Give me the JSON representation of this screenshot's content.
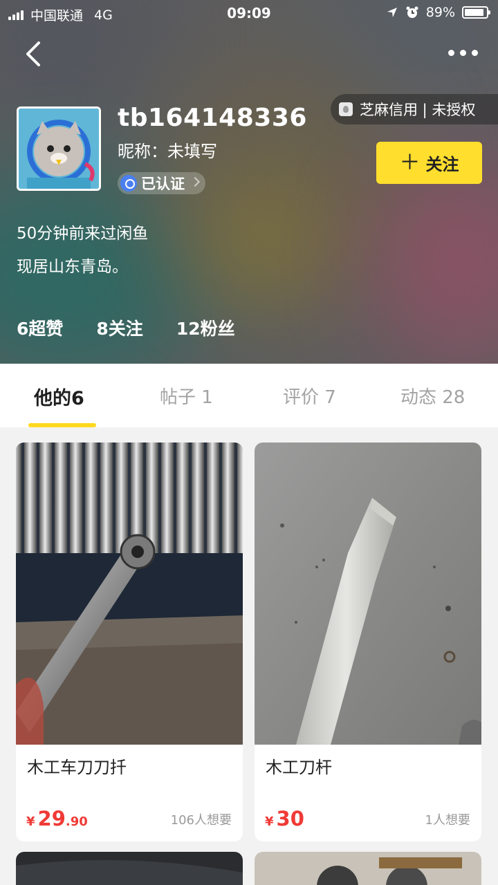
{
  "status_bar": {
    "carrier": "中国联通",
    "network": "4G",
    "time": "09:09",
    "battery": "89%",
    "battery_level": 0.89
  },
  "profile": {
    "username": "tb164148336",
    "nickname": "昵称：未填写",
    "verified_label": "已认证",
    "credit": "芝麻信用 | 未授权",
    "follow_label": "关注",
    "last_seen": "50分钟前来过闲鱼",
    "location": "现居山东青岛。",
    "stats": {
      "likes": "6超赞",
      "following": "8关注",
      "fans": "12粉丝"
    }
  },
  "tabs": [
    {
      "label": "他的6"
    },
    {
      "label": "帖子 1"
    },
    {
      "label": "评价 7"
    },
    {
      "label": "动态 28"
    }
  ],
  "items": [
    {
      "title": "木工车刀刀扦",
      "currency": "¥",
      "price_int": "29",
      "price_dec": ".90",
      "wants": "106人想要"
    },
    {
      "title": "木工刀杆",
      "currency": "¥",
      "price_int": "30",
      "price_dec": "",
      "wants": "1人想要"
    }
  ],
  "colors": {
    "accent": "#ffde2e",
    "price": "#f03a36",
    "tab_underline": "#ffd81f"
  }
}
